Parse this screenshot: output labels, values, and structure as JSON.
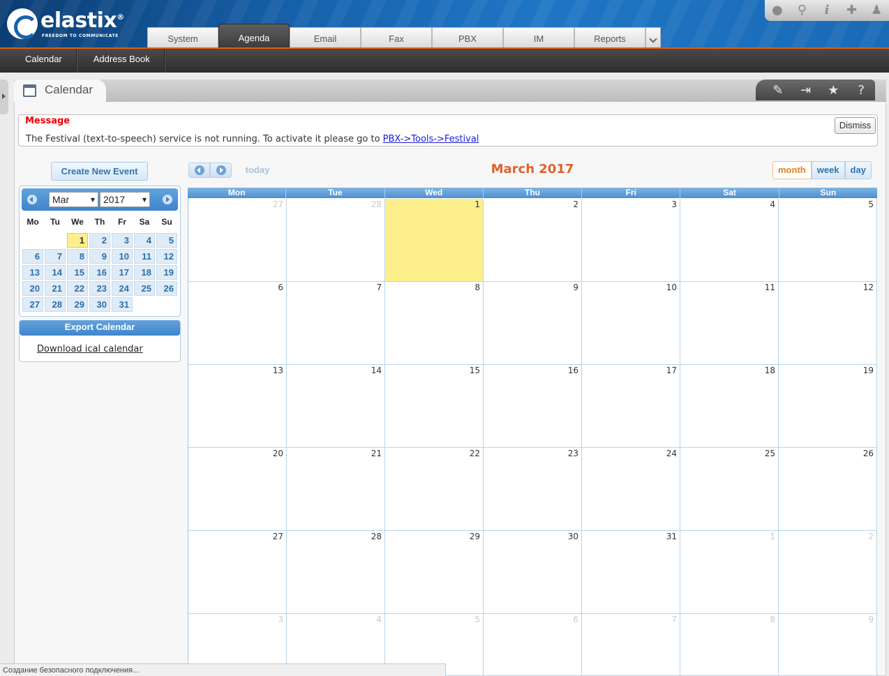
{
  "brand": {
    "name": "elastix",
    "tagline": "FREEDOM TO COMMUNICATE",
    "registered": "®"
  },
  "main_tabs": [
    {
      "label": "System",
      "active": false
    },
    {
      "label": "Agenda",
      "active": true
    },
    {
      "label": "Email",
      "active": false
    },
    {
      "label": "Fax",
      "active": false
    },
    {
      "label": "PBX",
      "active": false
    },
    {
      "label": "IM",
      "active": false
    },
    {
      "label": "Reports",
      "active": false
    }
  ],
  "top_icons": [
    "drop-icon",
    "search-icon",
    "info-icon",
    "tools-icon",
    "user-icon"
  ],
  "sub_menu": [
    {
      "label": "Calendar"
    },
    {
      "label": "Address Book"
    }
  ],
  "module": {
    "title": "Calendar"
  },
  "module_tools": [
    "edit-icon",
    "logout-icon",
    "star-icon",
    "help-icon"
  ],
  "message": {
    "title": "Message",
    "text": "The Festival (text-to-speech) service is not running. To activate it please go to ",
    "link": "PBX->Tools->Festival",
    "dismiss": "Dismiss"
  },
  "left": {
    "create_button": "Create New Event",
    "mini_calendar": {
      "month": "Mar",
      "year": "2017",
      "weekdays": [
        "Mo",
        "Tu",
        "We",
        "Th",
        "Fr",
        "Sa",
        "Su"
      ],
      "days": [
        [
          "",
          "",
          "1",
          "2",
          "3",
          "4",
          "5"
        ],
        [
          "6",
          "7",
          "8",
          "9",
          "10",
          "11",
          "12"
        ],
        [
          "13",
          "14",
          "15",
          "16",
          "17",
          "18",
          "19"
        ],
        [
          "20",
          "21",
          "22",
          "23",
          "24",
          "25",
          "26"
        ],
        [
          "27",
          "28",
          "29",
          "30",
          "31",
          "",
          ""
        ]
      ],
      "today": "1"
    },
    "export": {
      "title": "Export Calendar",
      "link": "Download ical calendar"
    }
  },
  "calendar": {
    "title": "March 2017",
    "today_label": "today",
    "views": [
      "month",
      "week",
      "day"
    ],
    "active_view": "month",
    "weekdays": [
      "Mon",
      "Tue",
      "Wed",
      "Thu",
      "Fri",
      "Sat",
      "Sun"
    ],
    "weeks": [
      [
        {
          "d": "27",
          "o": true
        },
        {
          "d": "28",
          "o": true
        },
        {
          "d": "1",
          "t": true
        },
        {
          "d": "2"
        },
        {
          "d": "3"
        },
        {
          "d": "4"
        },
        {
          "d": "5"
        }
      ],
      [
        {
          "d": "6"
        },
        {
          "d": "7"
        },
        {
          "d": "8"
        },
        {
          "d": "9"
        },
        {
          "d": "10"
        },
        {
          "d": "11"
        },
        {
          "d": "12"
        }
      ],
      [
        {
          "d": "13"
        },
        {
          "d": "14"
        },
        {
          "d": "15"
        },
        {
          "d": "16"
        },
        {
          "d": "17"
        },
        {
          "d": "18"
        },
        {
          "d": "19"
        }
      ],
      [
        {
          "d": "20"
        },
        {
          "d": "21"
        },
        {
          "d": "22"
        },
        {
          "d": "23"
        },
        {
          "d": "24"
        },
        {
          "d": "25"
        },
        {
          "d": "26"
        }
      ],
      [
        {
          "d": "27"
        },
        {
          "d": "28"
        },
        {
          "d": "29"
        },
        {
          "d": "30"
        },
        {
          "d": "31"
        },
        {
          "d": "1",
          "o": true
        },
        {
          "d": "2",
          "o": true
        }
      ],
      [
        {
          "d": "3",
          "o": true
        },
        {
          "d": "4",
          "o": true
        },
        {
          "d": "5",
          "o": true
        },
        {
          "d": "6",
          "o": true
        },
        {
          "d": "7",
          "o": true
        },
        {
          "d": "8",
          "o": true
        },
        {
          "d": "9",
          "o": true
        }
      ]
    ]
  },
  "status_bar": "Создание безопасного подключения..."
}
